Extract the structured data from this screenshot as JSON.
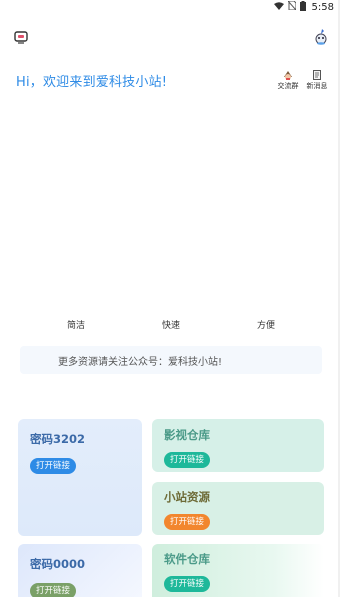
{
  "status_bar": {
    "time": "5:58",
    "icons": [
      "wifi-icon",
      "sim-off-icon",
      "battery-icon"
    ]
  },
  "header": {
    "left_icon": "tv-icon",
    "right_icon": "mascot-icon"
  },
  "greeting": "Hi，欢迎来到爱科技小站!",
  "quick_actions": [
    {
      "label": "交流群",
      "icon": "group-chat-icon"
    },
    {
      "label": "新消息",
      "icon": "message-icon"
    }
  ],
  "features": [
    "简洁",
    "快速",
    "方便"
  ],
  "notice": "更多资源请关注公众号：爱科技小站!",
  "cards": {
    "code1": {
      "title": "密码3202",
      "action": "打开链接"
    },
    "movie": {
      "title": "影视仓库",
      "action": "打开链接"
    },
    "station": {
      "title": "小站资源",
      "action": "打开链接"
    },
    "code2": {
      "title": "密码0000",
      "action": "打开链接"
    },
    "software": {
      "title": "软件仓库",
      "action": "打开链接"
    }
  },
  "colors": {
    "accent_blue": "#2e8be6",
    "teal": "#1eb89a",
    "orange": "#f2862e",
    "olive_green": "#7aa067"
  }
}
